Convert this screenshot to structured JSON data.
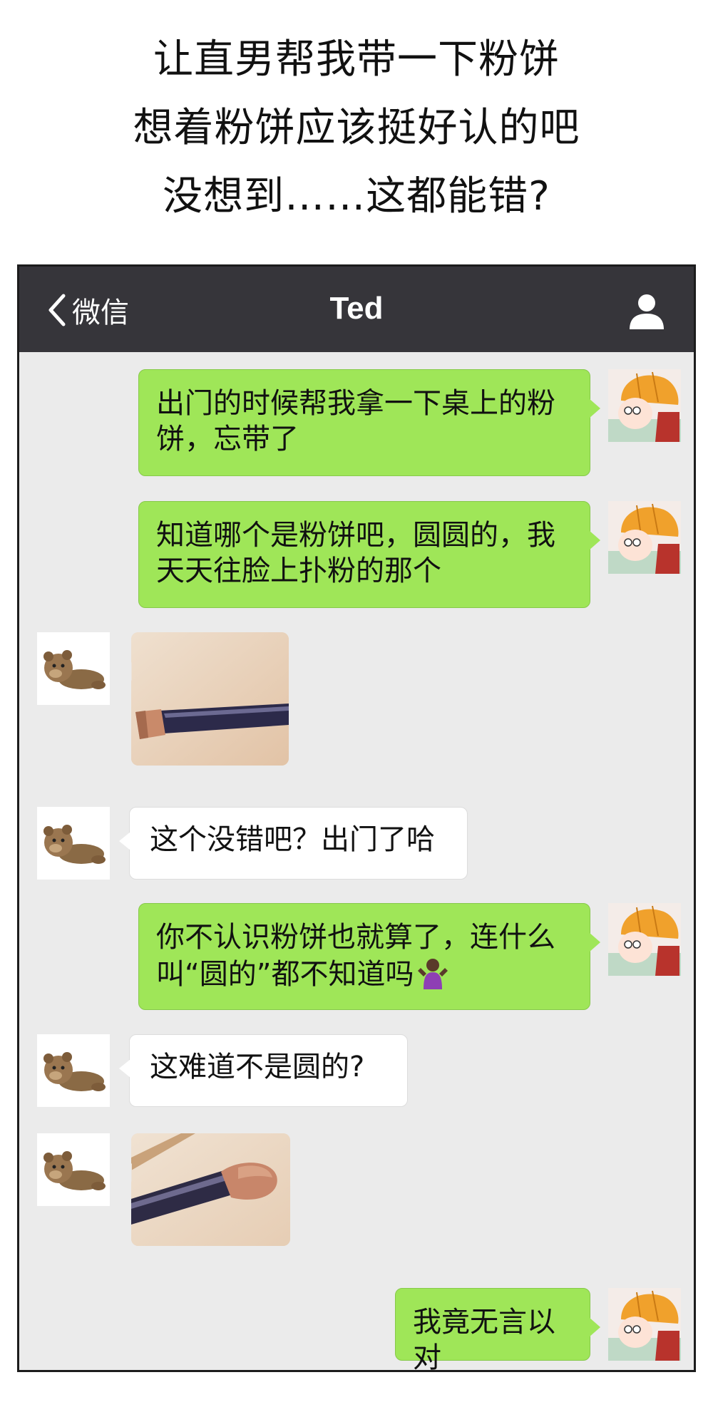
{
  "caption": {
    "lines": [
      "让直男帮我带一下粉饼",
      "想着粉饼应该挺好认的吧",
      "没想到……这都能错?"
    ]
  },
  "navbar": {
    "back_label": "微信",
    "title": "Ted",
    "icons": {
      "back": "chevron-left-icon",
      "contact": "person-icon"
    }
  },
  "chat": {
    "messages": [
      {
        "from": "me",
        "type": "text",
        "lines": [
          "出门的时候帮我拿一下桌上的粉",
          "饼，忘带了"
        ]
      },
      {
        "from": "me",
        "type": "text",
        "lines": [
          "知道哪个是粉饼吧，圆圆的，我",
          "天天往脸上扑粉的那个"
        ]
      },
      {
        "from": "ted",
        "type": "image",
        "depicts": "makeup brush"
      },
      {
        "from": "ted",
        "type": "text",
        "lines": [
          "这个没错吧？出门了哈"
        ]
      },
      {
        "from": "me",
        "type": "text",
        "lines": [
          "你不认识粉饼也就算了，连什么",
          "叫“圆的”都不知道吗"
        ],
        "emoji": "shrug-emoji-icon"
      },
      {
        "from": "ted",
        "type": "text",
        "lines": [
          "这难道不是圆的?"
        ]
      },
      {
        "from": "ted",
        "type": "image",
        "depicts": "makeup brush"
      },
      {
        "from": "me",
        "type": "text",
        "lines": [
          "我竟无言以对"
        ]
      }
    ]
  },
  "colors": {
    "navbar_bg": "#36353a",
    "chat_bg": "#ebebeb",
    "my_bubble": "#9fe658",
    "their_bubble": "#ffffff"
  }
}
